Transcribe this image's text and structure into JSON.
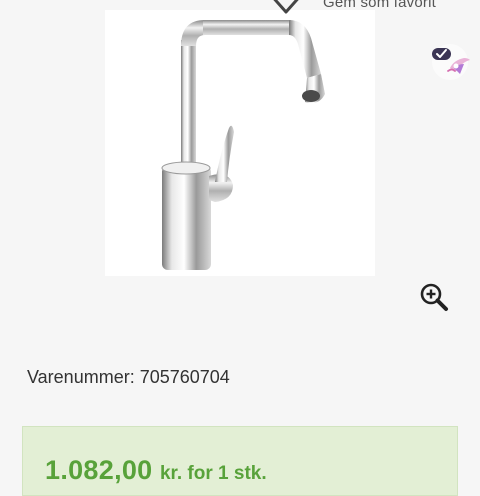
{
  "favorite": {
    "label": "Gem som favorit",
    "icon": "heart-outline-icon"
  },
  "product_image": {
    "subject": "faucet-icon",
    "background": "#ffffff"
  },
  "brand_badge": {
    "icon": "brand-badge-icon"
  },
  "zoom": {
    "icon": "zoom-in-icon"
  },
  "product": {
    "sku_line": "Varenummer: 705760704"
  },
  "price": {
    "amount": "1.082,00",
    "unit": "kr. for 1 stk."
  },
  "colors": {
    "price_text": "#58a23a",
    "price_box": "#e3efd5",
    "page_background": "#f6f6f6"
  }
}
